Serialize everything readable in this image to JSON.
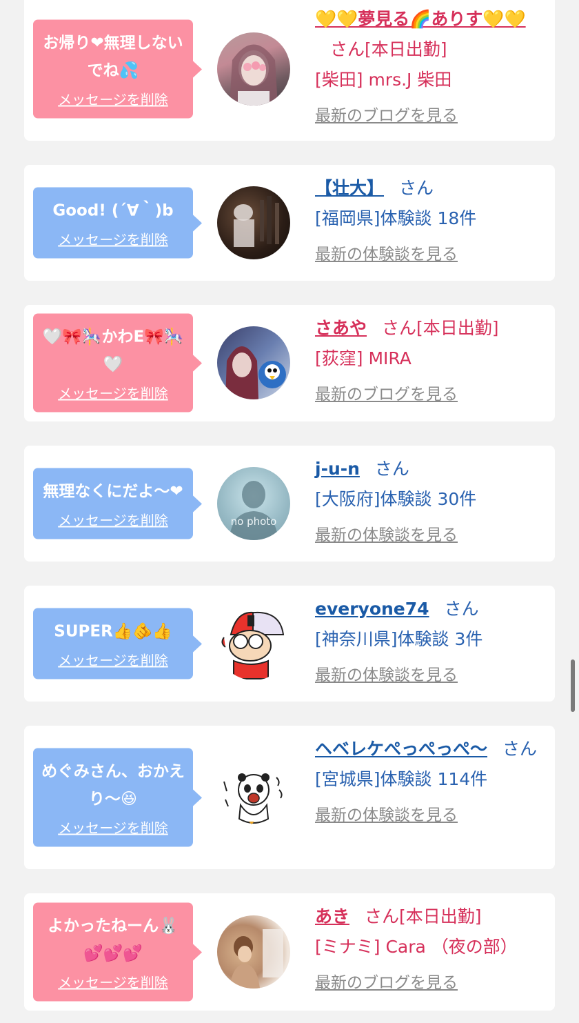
{
  "colors": {
    "pink_bubble": "#fc91a3",
    "blue_bubble": "#8bb7f5",
    "pink_text": "#d6305a",
    "blue_text": "#1a5aa6",
    "gray_link": "#8a8a8a",
    "background": "#f2f2f2"
  },
  "delete_label": "メッセージを削除",
  "cards": [
    {
      "message": "お帰り❤無理しないでね💦",
      "name": "💛💛夢見る🌈ありす💛💛",
      "san": "さん[本日出勤]",
      "sub": "[柴田] mrs.J 柴田",
      "more": "最新のブログを見る"
    },
    {
      "message": "Good! (´∀｀)b",
      "name": "【壮大】",
      "san": "さん",
      "sub": "[福岡県]体験談 18件",
      "more": "最新の体験談を見る"
    },
    {
      "message": "🤍🎀🎠かわE🎀🎠🤍",
      "name": "さあや",
      "san": "さん[本日出勤]",
      "sub": "[荻窪] MIRA",
      "more": "最新のブログを見る"
    },
    {
      "message": "無理なくにだよ〜❤",
      "name": "j-u-n",
      "san": "さん",
      "sub": "[大阪府]体験談 30件",
      "more": "最新の体験談を見る",
      "avatar_label": "no photo"
    },
    {
      "message": "SUPER👍🫵👍",
      "name": "everyone74",
      "san": "さん",
      "sub": "[神奈川県]体験談 3件",
      "more": "最新の体験談を見る"
    },
    {
      "message": "めぐみさん、おかえり〜😆",
      "name": "ヘベレケぺっぺっぺ〜",
      "san": "さん",
      "sub": "[宮城県]体験談 114件",
      "more": "最新の体験談を見る"
    },
    {
      "message": "よかったねーん🐰💕💕💕",
      "name": "あき",
      "san": "さん[本日出勤]",
      "sub": "[ミナミ] Cara （夜の部）",
      "more": "最新のブログを見る"
    }
  ]
}
